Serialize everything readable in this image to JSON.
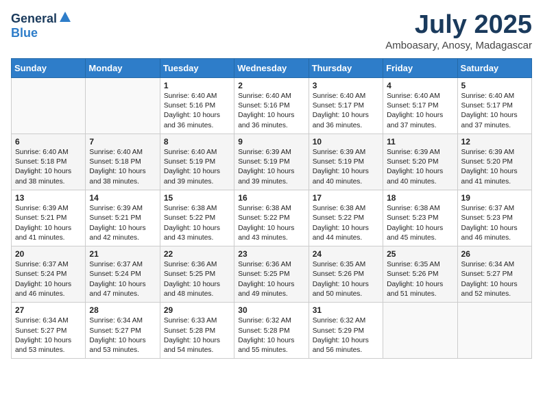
{
  "logo": {
    "line1": "General",
    "line2": "Blue"
  },
  "title": "July 2025",
  "location": "Amboasary, Anosy, Madagascar",
  "days_of_week": [
    "Sunday",
    "Monday",
    "Tuesday",
    "Wednesday",
    "Thursday",
    "Friday",
    "Saturday"
  ],
  "weeks": [
    [
      {
        "day": "",
        "content": ""
      },
      {
        "day": "",
        "content": ""
      },
      {
        "day": "1",
        "content": "Sunrise: 6:40 AM\nSunset: 5:16 PM\nDaylight: 10 hours and 36 minutes."
      },
      {
        "day": "2",
        "content": "Sunrise: 6:40 AM\nSunset: 5:16 PM\nDaylight: 10 hours and 36 minutes."
      },
      {
        "day": "3",
        "content": "Sunrise: 6:40 AM\nSunset: 5:17 PM\nDaylight: 10 hours and 36 minutes."
      },
      {
        "day": "4",
        "content": "Sunrise: 6:40 AM\nSunset: 5:17 PM\nDaylight: 10 hours and 37 minutes."
      },
      {
        "day": "5",
        "content": "Sunrise: 6:40 AM\nSunset: 5:17 PM\nDaylight: 10 hours and 37 minutes."
      }
    ],
    [
      {
        "day": "6",
        "content": "Sunrise: 6:40 AM\nSunset: 5:18 PM\nDaylight: 10 hours and 38 minutes."
      },
      {
        "day": "7",
        "content": "Sunrise: 6:40 AM\nSunset: 5:18 PM\nDaylight: 10 hours and 38 minutes."
      },
      {
        "day": "8",
        "content": "Sunrise: 6:40 AM\nSunset: 5:19 PM\nDaylight: 10 hours and 39 minutes."
      },
      {
        "day": "9",
        "content": "Sunrise: 6:39 AM\nSunset: 5:19 PM\nDaylight: 10 hours and 39 minutes."
      },
      {
        "day": "10",
        "content": "Sunrise: 6:39 AM\nSunset: 5:19 PM\nDaylight: 10 hours and 40 minutes."
      },
      {
        "day": "11",
        "content": "Sunrise: 6:39 AM\nSunset: 5:20 PM\nDaylight: 10 hours and 40 minutes."
      },
      {
        "day": "12",
        "content": "Sunrise: 6:39 AM\nSunset: 5:20 PM\nDaylight: 10 hours and 41 minutes."
      }
    ],
    [
      {
        "day": "13",
        "content": "Sunrise: 6:39 AM\nSunset: 5:21 PM\nDaylight: 10 hours and 41 minutes."
      },
      {
        "day": "14",
        "content": "Sunrise: 6:39 AM\nSunset: 5:21 PM\nDaylight: 10 hours and 42 minutes."
      },
      {
        "day": "15",
        "content": "Sunrise: 6:38 AM\nSunset: 5:22 PM\nDaylight: 10 hours and 43 minutes."
      },
      {
        "day": "16",
        "content": "Sunrise: 6:38 AM\nSunset: 5:22 PM\nDaylight: 10 hours and 43 minutes."
      },
      {
        "day": "17",
        "content": "Sunrise: 6:38 AM\nSunset: 5:22 PM\nDaylight: 10 hours and 44 minutes."
      },
      {
        "day": "18",
        "content": "Sunrise: 6:38 AM\nSunset: 5:23 PM\nDaylight: 10 hours and 45 minutes."
      },
      {
        "day": "19",
        "content": "Sunrise: 6:37 AM\nSunset: 5:23 PM\nDaylight: 10 hours and 46 minutes."
      }
    ],
    [
      {
        "day": "20",
        "content": "Sunrise: 6:37 AM\nSunset: 5:24 PM\nDaylight: 10 hours and 46 minutes."
      },
      {
        "day": "21",
        "content": "Sunrise: 6:37 AM\nSunset: 5:24 PM\nDaylight: 10 hours and 47 minutes."
      },
      {
        "day": "22",
        "content": "Sunrise: 6:36 AM\nSunset: 5:25 PM\nDaylight: 10 hours and 48 minutes."
      },
      {
        "day": "23",
        "content": "Sunrise: 6:36 AM\nSunset: 5:25 PM\nDaylight: 10 hours and 49 minutes."
      },
      {
        "day": "24",
        "content": "Sunrise: 6:35 AM\nSunset: 5:26 PM\nDaylight: 10 hours and 50 minutes."
      },
      {
        "day": "25",
        "content": "Sunrise: 6:35 AM\nSunset: 5:26 PM\nDaylight: 10 hours and 51 minutes."
      },
      {
        "day": "26",
        "content": "Sunrise: 6:34 AM\nSunset: 5:27 PM\nDaylight: 10 hours and 52 minutes."
      }
    ],
    [
      {
        "day": "27",
        "content": "Sunrise: 6:34 AM\nSunset: 5:27 PM\nDaylight: 10 hours and 53 minutes."
      },
      {
        "day": "28",
        "content": "Sunrise: 6:34 AM\nSunset: 5:27 PM\nDaylight: 10 hours and 53 minutes."
      },
      {
        "day": "29",
        "content": "Sunrise: 6:33 AM\nSunset: 5:28 PM\nDaylight: 10 hours and 54 minutes."
      },
      {
        "day": "30",
        "content": "Sunrise: 6:32 AM\nSunset: 5:28 PM\nDaylight: 10 hours and 55 minutes."
      },
      {
        "day": "31",
        "content": "Sunrise: 6:32 AM\nSunset: 5:29 PM\nDaylight: 10 hours and 56 minutes."
      },
      {
        "day": "",
        "content": ""
      },
      {
        "day": "",
        "content": ""
      }
    ]
  ]
}
